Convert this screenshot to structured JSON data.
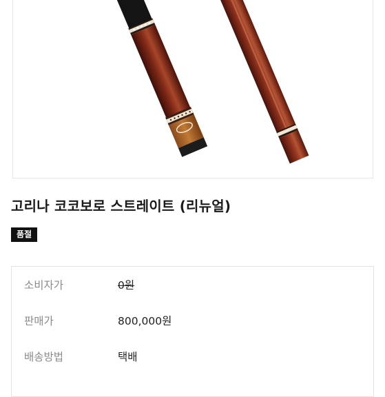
{
  "product": {
    "title": "고리나 코코보로 스트레이트 (리뉴얼)",
    "status_badge": "품절",
    "image_alt": "billiard-cue-product-photo",
    "details": [
      {
        "label": "소비자가",
        "value": "0원",
        "strikethrough": true
      },
      {
        "label": "판매가",
        "value": "800,000원"
      },
      {
        "label": "배송방법",
        "value": "택배"
      }
    ]
  },
  "colors": {
    "wood_dark": "#5a1a10",
    "wood_mid": "#8a2d1a",
    "wood_light": "#b04a2a",
    "badge_bg": "#111111"
  }
}
